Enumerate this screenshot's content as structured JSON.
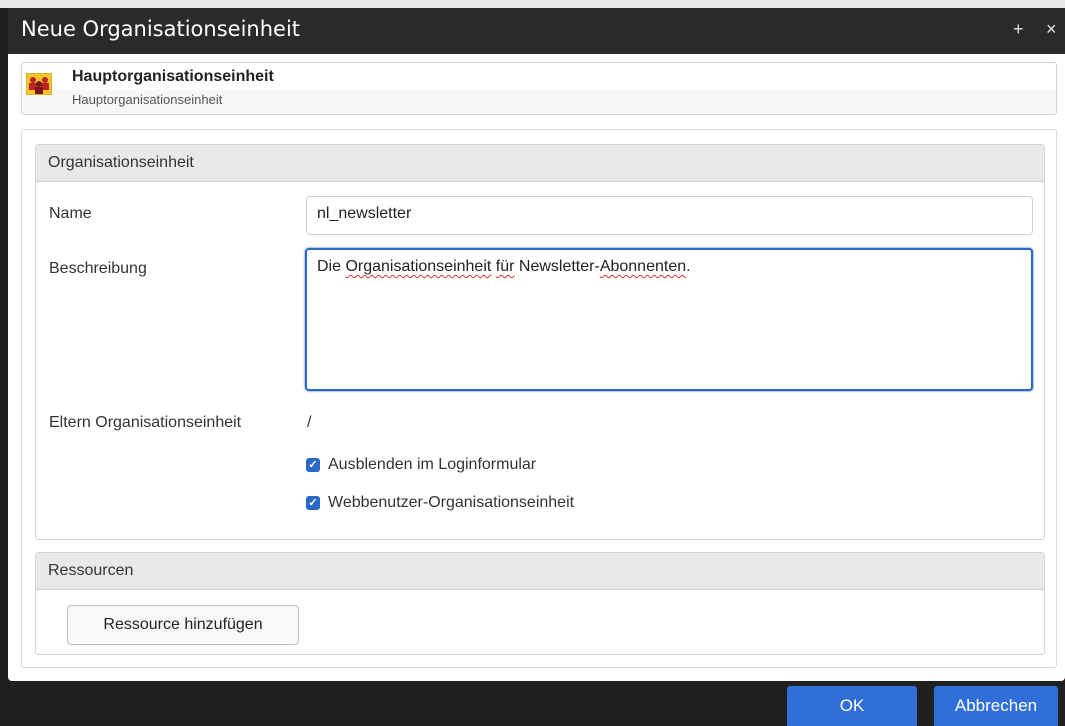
{
  "window": {
    "title": "Neue Organisationseinheit",
    "add_glyph": "+",
    "close_glyph": "×"
  },
  "breadcrumb": {
    "icon": "org-unit-icon",
    "title": "Hauptorganisationseinheit",
    "subtitle": "Hauptorganisationseinheit"
  },
  "org_section": {
    "header": "Organisationseinheit",
    "name_label": "Name",
    "name_value": "nl_newsletter",
    "desc_label": "Beschreibung",
    "desc_value_words": {
      "w1": "Die ",
      "w2": "Organisationseinheit",
      "w3": " ",
      "w4": "für",
      "w5": " Newsletter-",
      "w6": "Abonnenten",
      "w7": "."
    },
    "parent_label": "Eltern Organisationseinheit",
    "parent_value": "/",
    "checkbox_hide": {
      "label": "Ausblenden im Loginformular",
      "checked": true
    },
    "checkbox_web": {
      "label": "Webbenutzer-Organisationseinheit",
      "checked": true
    }
  },
  "resources_section": {
    "header": "Ressourcen",
    "add_button": "Ressource hinzufügen"
  },
  "footer": {
    "ok": "OK",
    "cancel": "Abbrechen"
  },
  "colors": {
    "accent": "#2f6fd7",
    "titlebar": "#2a2a2a",
    "section_header": "#e9e9e9"
  }
}
